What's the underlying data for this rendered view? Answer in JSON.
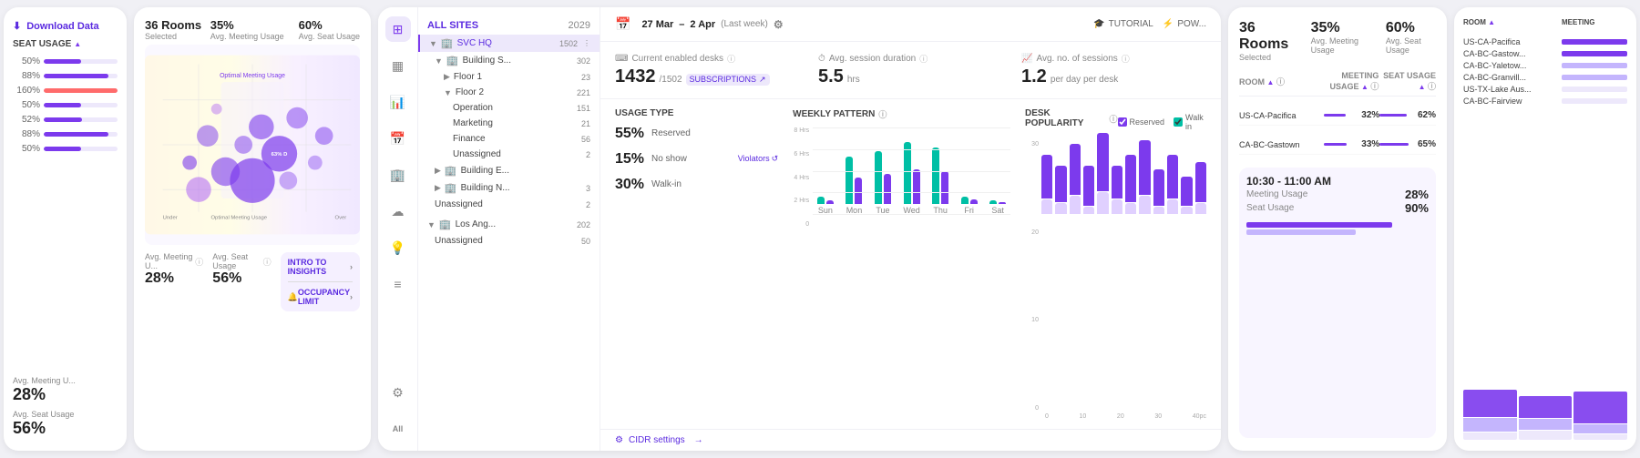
{
  "panel_left": {
    "download_label": "Download Data",
    "seat_usage_label": "SEAT USAGE",
    "bars": [
      {
        "label": "50%",
        "fill": 50
      },
      {
        "label": "88%",
        "fill": 88
      },
      {
        "label": "160%",
        "fill": 100
      },
      {
        "label": "50%",
        "fill": 50
      },
      {
        "label": "52%",
        "fill": 52
      },
      {
        "label": "88%",
        "fill": 88
      },
      {
        "label": "50%",
        "fill": 50
      }
    ],
    "avg_meeting_label": "Avg. Meeting U...",
    "avg_meeting_value": "28%",
    "avg_seat_label": "Avg. Seat Usage",
    "avg_seat_value": "56%"
  },
  "panel_bubble": {
    "rooms_label": "36 Rooms",
    "rooms_sub": "Selected",
    "pct1_label": "35%",
    "pct1_sub": "Avg. Meeting Usage",
    "pct2_label": "60%",
    "pct2_sub": "Avg. Seat Usage",
    "footer_meeting_label": "Avg. Meeting U...",
    "footer_meeting_value": "28%",
    "footer_seat_label": "Avg. Seat Usage",
    "footer_seat_value": "56%",
    "intro_label": "INTRO TO INSIGHTS",
    "occupancy_label": "OCCUPANCY LIMIT"
  },
  "tree_nav": {
    "all_sites_label": "ALL SITES",
    "year": "2029",
    "sites": [
      {
        "name": "SVC HQ",
        "count": "1502",
        "active": true,
        "children": [
          {
            "name": "Building S...",
            "count": "302",
            "children": [
              {
                "name": "Floor 1",
                "count": "23"
              },
              {
                "name": "Floor 2",
                "count": "221",
                "expanded": true,
                "children": [
                  {
                    "name": "Operation",
                    "count": "151"
                  },
                  {
                    "name": "Marketing",
                    "count": "21"
                  },
                  {
                    "name": "Finance",
                    "count": "56"
                  },
                  {
                    "name": "Unassigned",
                    "count": "2"
                  }
                ]
              }
            ]
          },
          {
            "name": "Building E...",
            "count": ""
          },
          {
            "name": "Building N...",
            "count": "3"
          },
          {
            "name": "Unassigned",
            "count": "2"
          }
        ]
      },
      {
        "name": "Los Ang...",
        "count": "202",
        "children": [
          {
            "name": "Unassigned",
            "count": "50"
          }
        ]
      }
    ]
  },
  "main_header": {
    "date_start": "27 Mar",
    "date_sep": "–",
    "date_end": "2 Apr",
    "week_label": "(Last week)",
    "tutorial_label": "TUTORIAL",
    "pow_label": "POW..."
  },
  "metrics": [
    {
      "label": "Current enabled desks",
      "value": "1432",
      "sub": "/1502",
      "sub2": "SUBSCRIPTIONS"
    },
    {
      "label": "Avg. session duration",
      "value": "5.5",
      "sub": "hrs"
    },
    {
      "label": "Avg. no. of sessions",
      "value": "1.2",
      "sub": "per day per desk"
    }
  ],
  "usage_type": {
    "title": "USAGE TYPE",
    "items": [
      {
        "pct": "55",
        "label": "Reserved",
        "fill": 55,
        "type": "reserved"
      },
      {
        "pct": "15",
        "label": "No show",
        "fill": 15,
        "type": "noshow"
      },
      {
        "pct": "30",
        "label": "Walk-in",
        "fill": 30,
        "type": "walkin"
      }
    ],
    "violators_label": "Violators"
  },
  "weekly_pattern": {
    "title": "WEEKLY PATTERN",
    "days": [
      {
        "label": "Sun",
        "teal": 10,
        "purple": 5
      },
      {
        "label": "Mon",
        "teal": 55,
        "purple": 30
      },
      {
        "label": "Tue",
        "teal": 60,
        "purple": 35
      },
      {
        "label": "Wed",
        "teal": 70,
        "purple": 40
      },
      {
        "label": "Thu",
        "teal": 65,
        "purple": 38
      },
      {
        "label": "Fri",
        "teal": 15,
        "purple": 8
      },
      {
        "label": "Sat",
        "teal": 5,
        "purple": 3
      }
    ]
  },
  "desk_popularity": {
    "title": "DESK POPULARITY",
    "legend_reserved": "Reserved",
    "legend_walkin": "Walk in",
    "bars": [
      {
        "reserved": 60,
        "walkin": 20
      },
      {
        "reserved": 50,
        "walkin": 15
      },
      {
        "reserved": 70,
        "walkin": 25
      },
      {
        "reserved": 55,
        "walkin": 10
      },
      {
        "reserved": 80,
        "walkin": 30
      },
      {
        "reserved": 45,
        "walkin": 20
      },
      {
        "reserved": 65,
        "walkin": 15
      },
      {
        "reserved": 75,
        "walkin": 25
      },
      {
        "reserved": 50,
        "walkin": 10
      },
      {
        "reserved": 60,
        "walkin": 20
      },
      {
        "reserved": 40,
        "walkin": 10
      },
      {
        "reserved": 55,
        "walkin": 15
      }
    ]
  },
  "cidr_label": "CIDR settings",
  "panel_right": {
    "rooms_selected": "36 Rooms",
    "rooms_sub": "Selected",
    "avg_meeting": "35%",
    "avg_meeting_sub": "Avg. Meeting Usage",
    "avg_seat": "60%",
    "avg_seat_sub": "Avg. Seat Usage",
    "col_room": "ROOM",
    "col_meeting": "MEETING USAGE",
    "col_seat": "SEAT USAGE",
    "rows": [
      {
        "room": "US-CA-Pacifica",
        "meeting": "32%",
        "seat": "62%",
        "meeting_fill": 32,
        "seat_fill": 62
      },
      {
        "room": "CA-BC-Gastown",
        "meeting": "33%",
        "seat": "65%",
        "meeting_fill": 33,
        "seat_fill": 65
      }
    ]
  },
  "panel_far_right": {
    "time_slot": "10:30 - 11:00 AM",
    "meeting_usage_label": "Meeting Usage",
    "meeting_usage_value": "28%",
    "seat_usage_label": "Seat Usage",
    "seat_usage_value": "90%",
    "col_room": "ROOM",
    "col_meeting": "MEETING",
    "rows": [
      {
        "room": "US-CA-Pacifica"
      },
      {
        "room": "CA-BC-Gastow..."
      },
      {
        "room": "CA-BC-Yaletow..."
      },
      {
        "room": "CA-BC-Granvill..."
      },
      {
        "room": "US-TX-Lake Aus..."
      },
      {
        "room": "CA-BC-Fairview"
      }
    ]
  }
}
